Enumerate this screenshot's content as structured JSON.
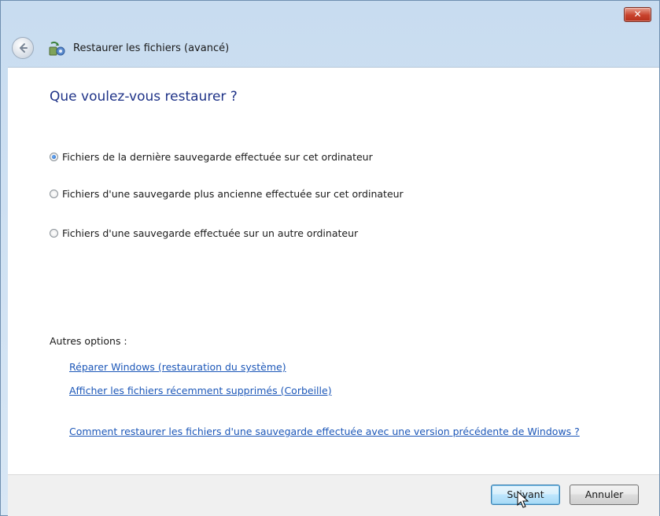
{
  "window": {
    "title": "Restaurer les fichiers (avancé)",
    "close_label": "✕"
  },
  "main": {
    "heading": "Que voulez-vous restaurer ?",
    "options": [
      {
        "label": "Fichiers de la dernière sauvegarde effectuée sur cet ordinateur",
        "checked": true
      },
      {
        "label": "Fichiers d'une sauvegarde plus ancienne effectuée sur cet ordinateur",
        "checked": false
      },
      {
        "label": "Fichiers d'une sauvegarde effectuée sur un autre ordinateur",
        "checked": false
      }
    ],
    "other_options_label": "Autres options :",
    "links": [
      "Réparer Windows (restauration du système)",
      "Afficher les fichiers récemment supprimés (Corbeille)",
      "Comment restaurer les fichiers d'une sauvegarde effectuée avec une version précédente de Windows ?"
    ]
  },
  "footer": {
    "next_label": "Suivant",
    "cancel_label": "Annuler"
  },
  "icons": {
    "back": "back-arrow-icon",
    "app": "restore-files-icon",
    "close": "close-icon"
  },
  "colors": {
    "heading": "#1e3287",
    "link": "#1c57b8",
    "close_button": "#c8422c"
  }
}
